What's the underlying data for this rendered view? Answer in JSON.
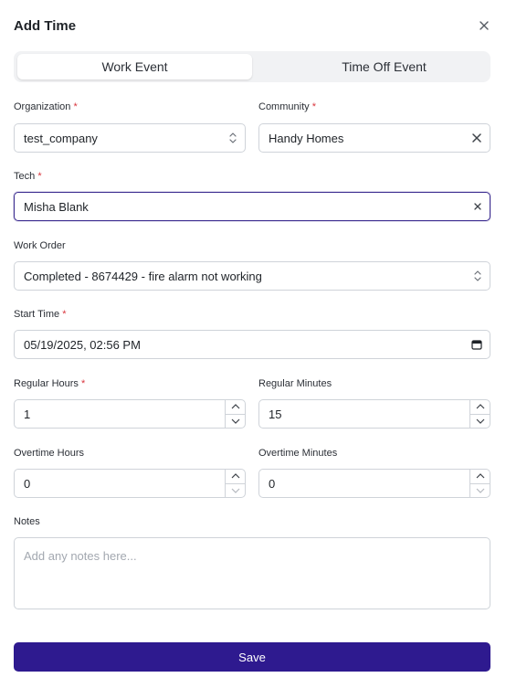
{
  "dialog": {
    "title": "Add Time",
    "close_icon": "close-icon"
  },
  "tabs": [
    {
      "label": "Work Event",
      "active": true
    },
    {
      "label": "Time Off Event",
      "active": false
    }
  ],
  "form": {
    "required_marker": "*",
    "organization": {
      "label": "Organization",
      "value": "test_company",
      "required": true
    },
    "community": {
      "label": "Community",
      "value": "Handy Homes",
      "required": true
    },
    "tech": {
      "label": "Tech",
      "value": "Misha Blank",
      "required": true
    },
    "work_order": {
      "label": "Work Order",
      "value": "Completed - 8674429 - fire alarm not working",
      "required": false
    },
    "start_time": {
      "label": "Start Time",
      "value": "05/19/2025, 02:56 PM",
      "required": true
    },
    "regular_hours": {
      "label": "Regular Hours",
      "value": "1",
      "required": true
    },
    "regular_minutes": {
      "label": "Regular Minutes",
      "value": "15",
      "required": false
    },
    "overtime_hours": {
      "label": "Overtime Hours",
      "value": "0",
      "required": false
    },
    "overtime_minutes": {
      "label": "Overtime Minutes",
      "value": "0",
      "required": false
    },
    "notes": {
      "label": "Notes",
      "value": "",
      "placeholder": "Add any notes here..."
    }
  },
  "actions": {
    "save_label": "Save"
  },
  "colors": {
    "accent": "#2e1a8f",
    "focus_border": "#3a2b8f",
    "required": "#d9363e"
  }
}
